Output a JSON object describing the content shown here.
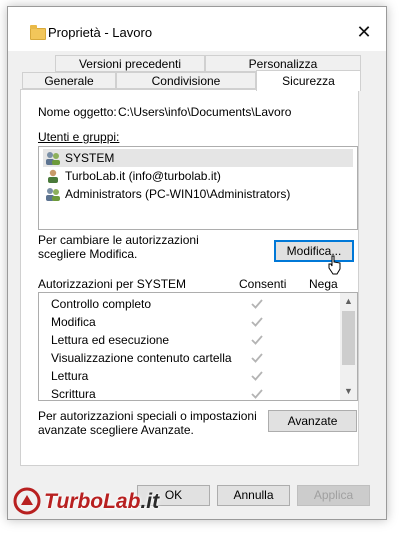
{
  "window": {
    "title": "Proprietà - Lavoro",
    "close_glyph": "✕"
  },
  "tabs": {
    "row1": [
      "Versioni precedenti",
      "Personalizza"
    ],
    "row2": [
      "Generale",
      "Condivisione",
      "Sicurezza"
    ],
    "active": "Sicurezza"
  },
  "security": {
    "object_label": "Nome oggetto:",
    "object_path": "C:\\Users\\info\\Documents\\Lavoro",
    "groups_label": "Utenti e gruppi:",
    "groups": [
      {
        "name": "SYSTEM",
        "selected": true
      },
      {
        "name": "TurboLab.it (info@turbolab.it)",
        "selected": false
      },
      {
        "name": "Administrators (PC-WIN10\\Administrators)",
        "selected": false
      }
    ],
    "change_hint_line1": "Per cambiare le autorizzazioni",
    "change_hint_line2": "scegliere Modifica.",
    "edit_button": "Modifica...",
    "perms_for_label": "Autorizzazioni per SYSTEM",
    "allow_header": "Consenti",
    "deny_header": "Nega",
    "permissions": [
      {
        "name": "Controllo completo",
        "allow": true
      },
      {
        "name": "Modifica",
        "allow": true
      },
      {
        "name": "Lettura ed esecuzione",
        "allow": true
      },
      {
        "name": "Visualizzazione contenuto cartella",
        "allow": true
      },
      {
        "name": "Lettura",
        "allow": true
      },
      {
        "name": "Scrittura",
        "allow": true
      }
    ],
    "advanced_hint_line1": "Per autorizzazioni speciali o impostazioni",
    "advanced_hint_line2": "avanzate scegliere Avanzate.",
    "advanced_button": "Avanzate"
  },
  "footer": {
    "ok": "OK",
    "cancel": "Annulla",
    "apply": "Applica"
  },
  "watermark": {
    "brand": "TurboLab",
    "suffix": ".it"
  },
  "colors": {
    "selection": "#e5e5e5",
    "focus": "#0078d7",
    "check": "#b4b4b4",
    "watermark": "#b82020"
  }
}
